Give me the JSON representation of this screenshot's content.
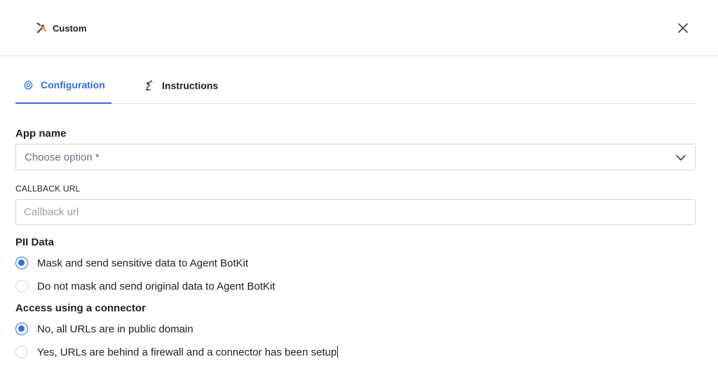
{
  "header": {
    "title": "Custom",
    "icon": "tools-icon",
    "close_icon": "close-icon"
  },
  "tabs": [
    {
      "label": "Configuration",
      "icon": "gear-icon",
      "active": true
    },
    {
      "label": "Instructions",
      "icon": "robot-arm-icon",
      "active": false
    }
  ],
  "app_name": {
    "label": "App name",
    "placeholder": "Choose option *"
  },
  "callback": {
    "label": "CALLBACK URL",
    "placeholder": "Callback url",
    "value": ""
  },
  "pii": {
    "label": "PII Data",
    "options": [
      {
        "text": "Mask and send sensitive data to Agent BotKit",
        "checked": true
      },
      {
        "text": "Do not mask and send original data to Agent BotKit",
        "checked": false
      }
    ]
  },
  "connector": {
    "label": "Access using a connector",
    "options": [
      {
        "text": "No, all URLs are in public domain",
        "checked": true
      },
      {
        "text": "Yes, URLs are behind a firewall and a connector has been setup",
        "checked": false
      }
    ]
  },
  "colors": {
    "accent": "#2f6fde",
    "text": "#202124",
    "border": "#cfd3d8"
  }
}
